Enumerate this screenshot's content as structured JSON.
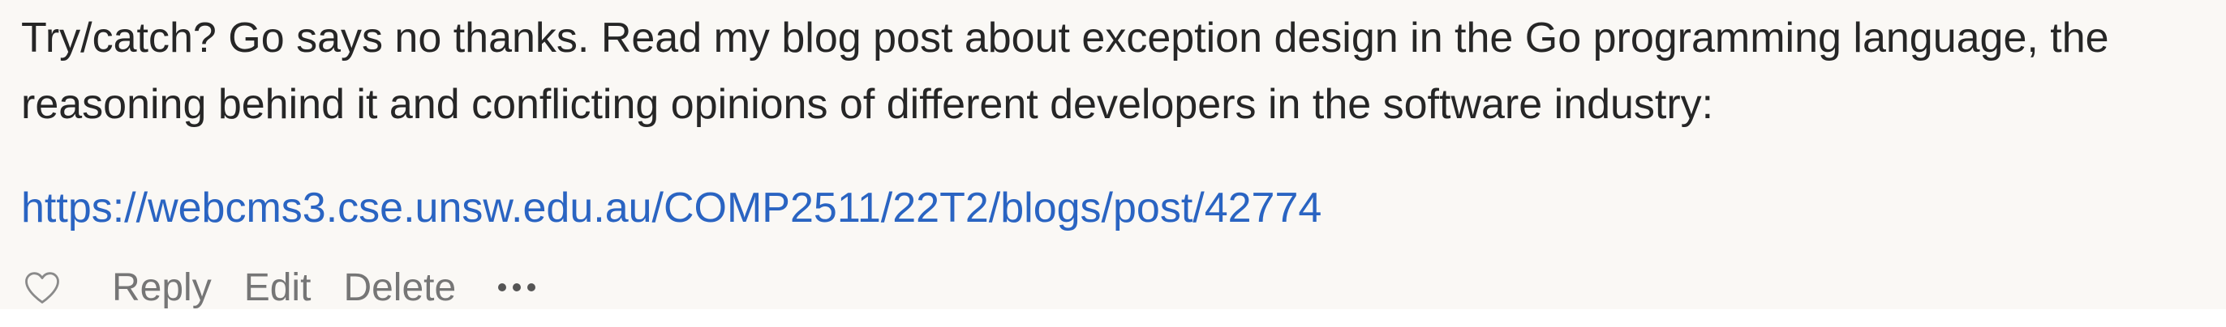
{
  "comment": {
    "text": "Try/catch? Go says no thanks. Read my blog post about exception design in the Go programming language, the reasoning behind it and conflicting opinions of different developers in the software industry:",
    "link": "https://webcms3.cse.unsw.edu.au/COMP2511/22T2/blogs/post/42774"
  },
  "actions": {
    "like_icon": "heart-outline-icon",
    "reply": "Reply",
    "edit": "Edit",
    "delete": "Delete",
    "more_icon": "more-horizontal-icon"
  },
  "colors": {
    "background": "#faf8f5",
    "text": "#262626",
    "link": "#2a64c2",
    "action": "#767676"
  }
}
